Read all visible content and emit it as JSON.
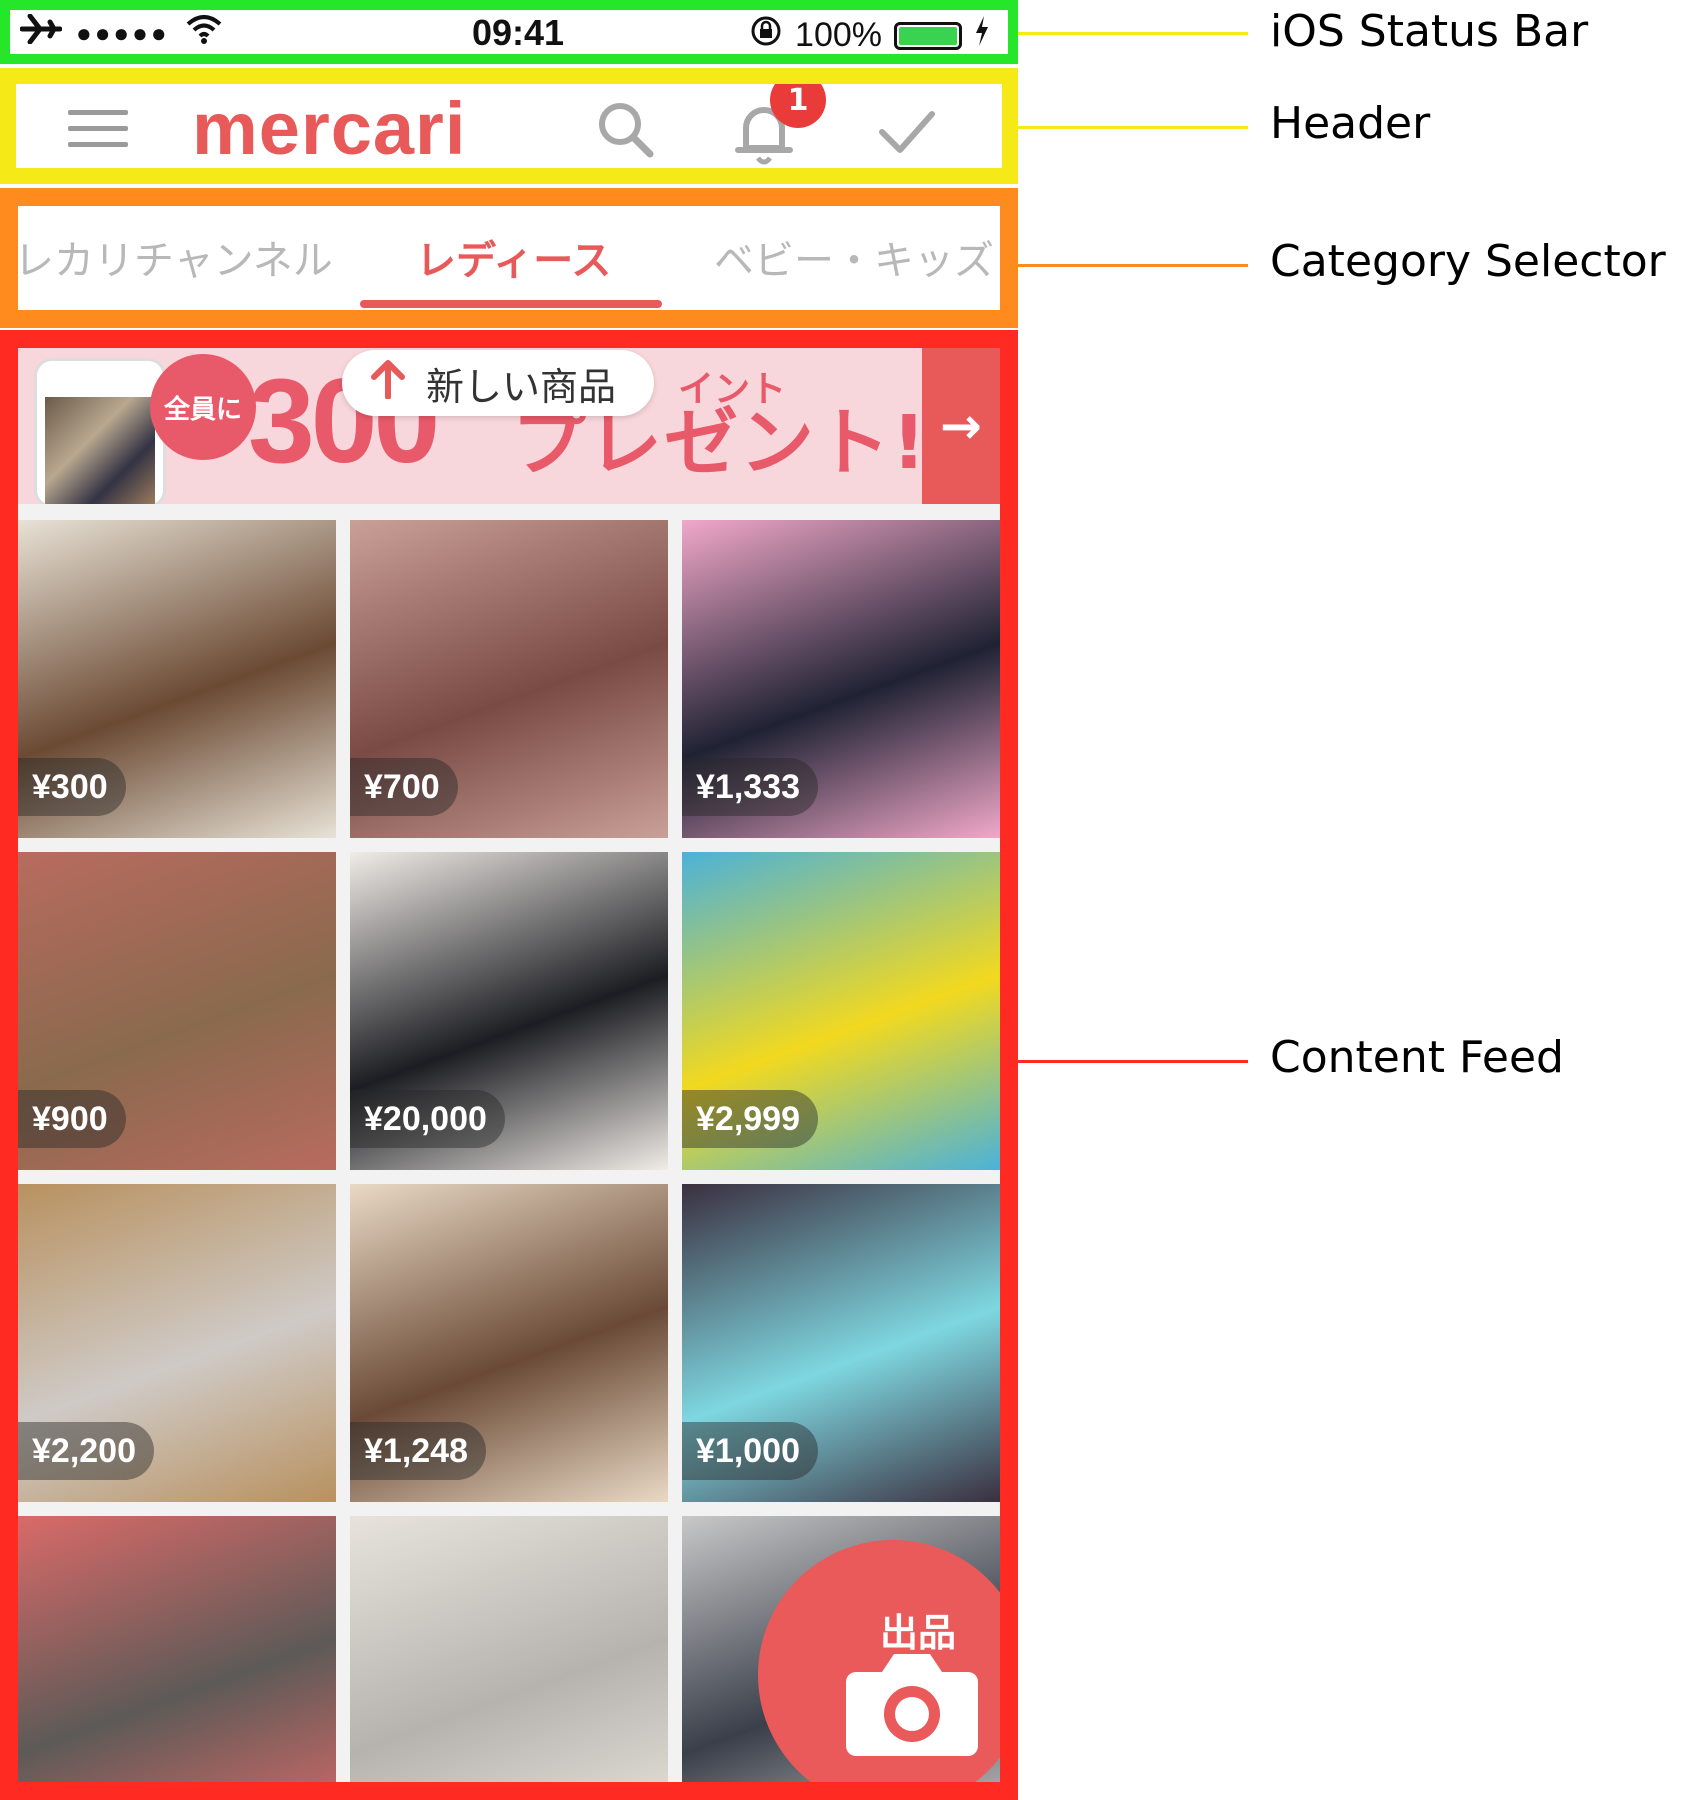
{
  "status_bar": {
    "signal_dots": "●●●●●",
    "time": "09:41",
    "battery_percent": "100%"
  },
  "header": {
    "logo": "mercari",
    "notification_count": "1"
  },
  "categories": {
    "tabs": [
      {
        "label": "メルカリチャンネル",
        "display": "レカリチャンネル"
      },
      {
        "label": "レディース"
      },
      {
        "label": "ベビー・キッズ"
      }
    ],
    "active_index": 1
  },
  "banner": {
    "circle_text": "全員に",
    "big_number": "300",
    "top_text": "イント",
    "main_text": "プレゼント!",
    "new_items_label": "新しい商品"
  },
  "items": [
    {
      "price": "¥300",
      "color_a": "#6b4a33",
      "color_b": "#e8e2d6"
    },
    {
      "price": "¥700",
      "color_a": "#7a4a44",
      "color_b": "#c9a098"
    },
    {
      "price": "¥1,333",
      "color_a": "#1f2233",
      "color_b": "#f1a8c9"
    },
    {
      "price": "¥900",
      "color_a": "#8a6a4d",
      "color_b": "#b86b5e"
    },
    {
      "price": "¥20,000",
      "color_a": "#1c1d22",
      "color_b": "#f0ece7"
    },
    {
      "price": "¥2,999",
      "color_a": "#f2d91f",
      "color_b": "#4bb2d9"
    },
    {
      "price": "¥2,200",
      "color_a": "#cfcac6",
      "color_b": "#b8915f"
    },
    {
      "price": "¥1,248",
      "color_a": "#6a4a36",
      "color_b": "#e9d9c4"
    },
    {
      "price": "¥1,000",
      "color_a": "#7ed7e0",
      "color_b": "#3b2f3f"
    },
    {
      "price": "",
      "color_a": "#5d5a57",
      "color_b": "#d96a68"
    },
    {
      "price": "",
      "color_a": "#b6b2ae",
      "color_b": "#e7e3dc"
    },
    {
      "price": "",
      "color_a": "#3a3f4a",
      "color_b": "#c8c8c8"
    }
  ],
  "fab": {
    "label": "出品"
  },
  "annotations": [
    {
      "label": "iOS Status Bar",
      "color": "#f5ea17"
    },
    {
      "label": "Header",
      "color": "#f5ea17"
    },
    {
      "label": "Category Selector",
      "color": "#ff8a1d"
    },
    {
      "label": "Content Feed",
      "color": "#ff2a22"
    }
  ],
  "colors": {
    "brand": "#e85a5a"
  }
}
